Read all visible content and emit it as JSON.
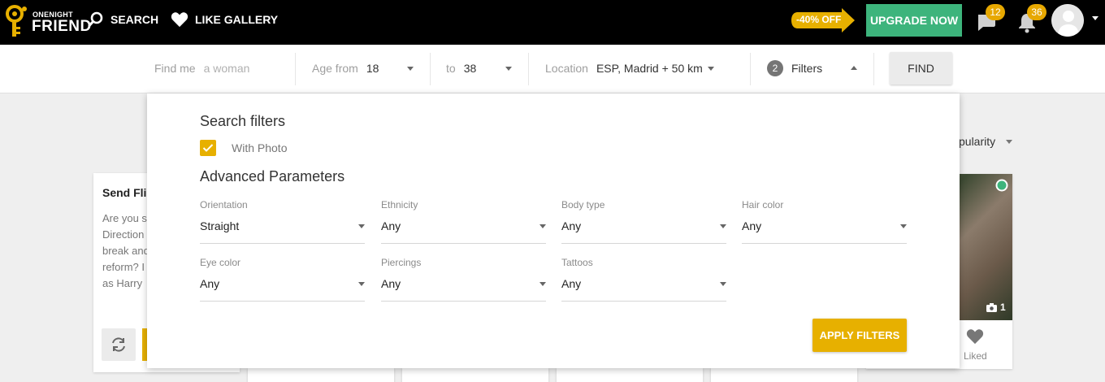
{
  "topbar": {
    "logo_small": "ONENIGHT",
    "logo_big": "FRIEND",
    "nav": [
      {
        "label": "SEARCH",
        "icon": "search-icon"
      },
      {
        "label": "LIKE GALLERY",
        "icon": "heart-icon"
      }
    ],
    "promo": "-40% OFF",
    "upgrade_label": "UPGRADE NOW",
    "messages_count": "12",
    "notifications_count": "36"
  },
  "searchbar": {
    "find_me_label": "Find me",
    "find_me_value": "a woman",
    "age_from_label": "Age from",
    "age_from_value": "18",
    "age_to_label": "to",
    "age_to_value": "38",
    "location_label": "Location",
    "location_value": "ESP, Madrid + 50 km",
    "filters_count": "2",
    "filters_label": "Filters",
    "find_label": "FIND"
  },
  "background": {
    "sort_label": "pularity",
    "flirt_title": "Send Flir",
    "flirt_text": "Are you s\nDirection\nbreak and\nreform? I\nas Harry",
    "photo_count": "1",
    "liked_label": "Liked"
  },
  "filters_panel": {
    "title": "Search filters",
    "with_photo_label": "With Photo",
    "with_photo_checked": true,
    "advanced_title": "Advanced Parameters",
    "fields": [
      {
        "label": "Orientation",
        "value": "Straight"
      },
      {
        "label": "Ethnicity",
        "value": "Any"
      },
      {
        "label": "Body type",
        "value": "Any"
      },
      {
        "label": "Hair color",
        "value": "Any"
      },
      {
        "label": "Eye color",
        "value": "Any"
      },
      {
        "label": "Piercings",
        "value": "Any"
      },
      {
        "label": "Tattoos",
        "value": "Any"
      }
    ],
    "apply_label": "APPLY FILTERS"
  },
  "colors": {
    "accent": "#e7b000",
    "upgrade": "#3db47c",
    "topbar": "#000000"
  }
}
